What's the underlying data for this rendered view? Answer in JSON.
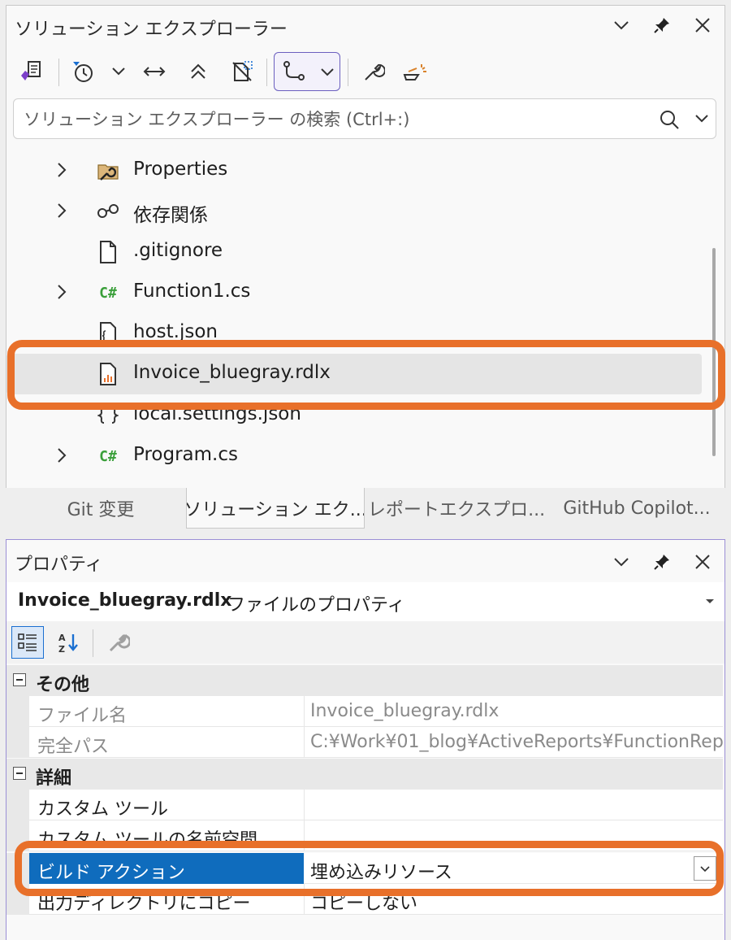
{
  "solution_explorer": {
    "title": "ソリューション エクスプローラー",
    "search_placeholder": "ソリューション エクスプローラー の検索 (Ctrl+:)",
    "tree": [
      {
        "label": "Properties",
        "icon": "properties-folder-icon",
        "expandable": true
      },
      {
        "label": "依存関係",
        "icon": "dependencies-icon",
        "expandable": true
      },
      {
        "label": ".gitignore",
        "icon": "file-icon",
        "expandable": false
      },
      {
        "label": "Function1.cs",
        "icon": "csharp-file-icon",
        "expandable": true
      },
      {
        "label": "host.json",
        "icon": "json-file-icon",
        "expandable": false
      },
      {
        "label": "Invoice_bluegray.rdlx",
        "icon": "report-file-icon",
        "expandable": false,
        "selected": true
      },
      {
        "label": "local.settings.json",
        "icon": "json-settings-icon",
        "expandable": false
      },
      {
        "label": "Program.cs",
        "icon": "csharp-file-icon",
        "expandable": true
      }
    ],
    "csharp_glyph": "C#"
  },
  "tabs": [
    {
      "label": "Git 変更",
      "active": false
    },
    {
      "label": "ソリューション エク...",
      "active": true
    },
    {
      "label": "レポートエクスプロ...",
      "active": false
    },
    {
      "label": "GitHub Copilot...",
      "active": false
    }
  ],
  "properties": {
    "title": "プロパティ",
    "object_name": "Invoice_bluegray.rdlx",
    "object_type": "ファイルのプロパティ",
    "categories": [
      {
        "label": "その他",
        "rows": [
          {
            "name": "ファイル名",
            "value": "Invoice_bluegray.rdlx",
            "readonly": true
          },
          {
            "name": "完全パス",
            "value": "C:¥Work¥01_blog¥ActiveReports¥FunctionRep",
            "readonly": true
          }
        ]
      },
      {
        "label": "詳細",
        "rows": [
          {
            "name": "カスタム ツール",
            "value": ""
          },
          {
            "name": "カスタム ツールの名前空間",
            "value": ""
          },
          {
            "name": "ビルド アクション",
            "value": "埋め込みリソース",
            "selected": true
          },
          {
            "name": "出力ディレクトリにコピー",
            "value": "コピーしない"
          }
        ]
      }
    ]
  },
  "colors": {
    "highlight_orange": "#e8702a",
    "selection_blue": "#0f6cbd",
    "csharp_green": "#3a9f3a"
  }
}
